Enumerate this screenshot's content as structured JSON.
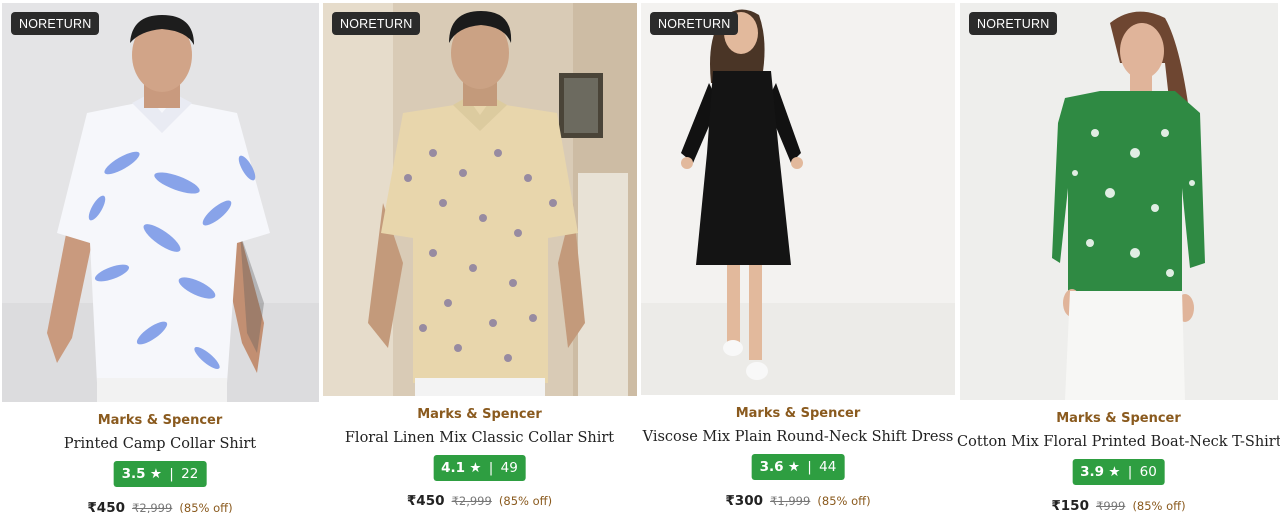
{
  "products": [
    {
      "badge": "NORETURN",
      "brand": "Marks & Spencer",
      "name": "Printed Camp Collar Shirt",
      "rating": "3.5",
      "star": "★",
      "separator": "|",
      "reviews": "22",
      "price": "₹450",
      "mrp": "₹2,999",
      "discount": "(85% off)",
      "image": "man-in-white-floral-shirt-image"
    },
    {
      "badge": "NORETURN",
      "brand": "Marks & Spencer",
      "name": "Floral Linen Mix Classic Collar Shirt",
      "rating": "4.1",
      "star": "★",
      "separator": "|",
      "reviews": "49",
      "price": "₹450",
      "mrp": "₹2,999",
      "discount": "(85% off)",
      "image": "man-in-beige-floral-shirt-image"
    },
    {
      "badge": "NORETURN",
      "brand": "Marks & Spencer",
      "name": "Viscose Mix Plain Round-Neck Shift Dress",
      "rating": "3.6",
      "star": "★",
      "separator": "|",
      "reviews": "44",
      "price": "₹300",
      "mrp": "₹1,999",
      "discount": "(85% off)",
      "image": "woman-in-black-dress-image"
    },
    {
      "badge": "NORETURN",
      "brand": "Marks & Spencer",
      "name": "Cotton Mix Floral Printed Boat-Neck T-Shirt",
      "rating": "3.9",
      "star": "★",
      "separator": "|",
      "reviews": "60",
      "price": "₹150",
      "mrp": "₹999",
      "discount": "(85% off)",
      "image": "woman-in-green-floral-top-image"
    }
  ],
  "colors": {
    "brand_text": "#8a5a1e",
    "rating_badge": "#2e9e41",
    "noreturn_badge": "#2b2b2b"
  }
}
